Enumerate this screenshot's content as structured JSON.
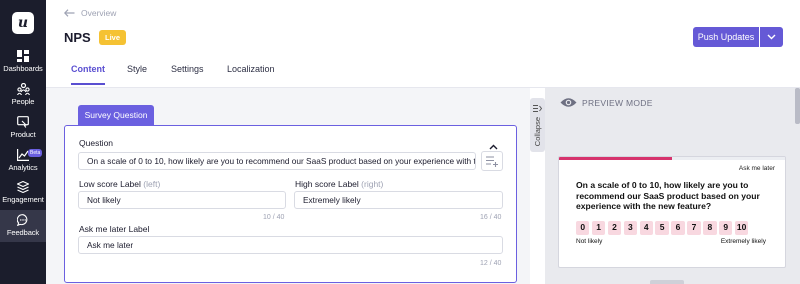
{
  "sidebar": {
    "logo": "u",
    "items": [
      {
        "label": "Dashboards",
        "icon": "dashboard-icon"
      },
      {
        "label": "People",
        "icon": "people-icon"
      },
      {
        "label": "Product",
        "icon": "product-icon"
      },
      {
        "label": "Analytics",
        "icon": "analytics-icon",
        "badge": "Beta"
      },
      {
        "label": "Engagement",
        "icon": "engagement-icon"
      },
      {
        "label": "Feedback",
        "icon": "feedback-icon",
        "active": true
      }
    ]
  },
  "header": {
    "breadcrumb": "Overview",
    "title": "NPS",
    "status_badge": "Live",
    "push_button": "Push Updates"
  },
  "tabs": [
    "Content",
    "Style",
    "Settings",
    "Localization"
  ],
  "editor": {
    "section_tab": "Survey Question",
    "question_label": "Question",
    "question_value": "On a scale of 0 to 10, how likely are you to recommend our SaaS product based on your experience with the new feature?",
    "low_label": "Low score Label",
    "low_hint": "(left)",
    "low_value": "Not likely",
    "low_counter": "10 / 40",
    "high_label": "High score Label",
    "high_hint": "(right)",
    "high_value": "Extremely likely",
    "high_counter": "16 / 40",
    "ask_label": "Ask me later Label",
    "ask_value": "Ask me later",
    "ask_counter": "12 / 40"
  },
  "collapse_label": "Collapse",
  "preview": {
    "mode_label": "PREVIEW MODE",
    "ask_later": "Ask me later",
    "question": "On a scale of 0 to 10, how likely are you to recommend our SaaS product based on your experience with the new feature?",
    "scale": [
      "0",
      "1",
      "2",
      "3",
      "4",
      "5",
      "6",
      "7",
      "8",
      "9",
      "10"
    ],
    "low": "Not likely",
    "high": "Extremely likely",
    "progress_fraction": 0.5
  },
  "colors": {
    "accent": "#6559d6",
    "live": "#f5c233",
    "progress": "#d6336c",
    "scale_bg": "#f8d8e0"
  }
}
